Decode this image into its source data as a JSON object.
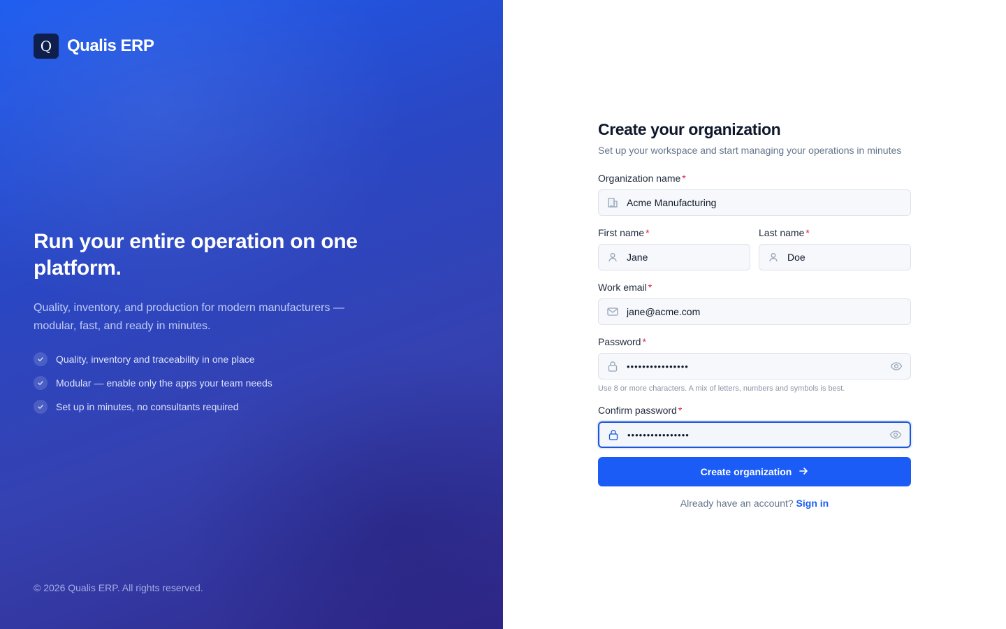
{
  "brand": {
    "logo_letter": "Q",
    "name": "Qualis ERP",
    "hero_title": "Run your entire operation on one platform.",
    "hero_subtitle": "Quality, inventory, and production for modern manufacturers — modular, fast, and ready in minutes.",
    "features": [
      "Quality, inventory and traceability in one place",
      "Modular — enable only the apps your team needs",
      "Set up in minutes, no consultants required"
    ],
    "copyright": "© 2026 Qualis ERP. All rights reserved."
  },
  "form": {
    "title": "Create your organization",
    "subtitle": "Set up your workspace and start managing your operations in minutes",
    "org_name": {
      "label": "Organization name",
      "value": "Acme Manufacturing"
    },
    "first_name": {
      "label": "First name",
      "value": "Jane"
    },
    "last_name": {
      "label": "Last name",
      "value": "Doe"
    },
    "email": {
      "label": "Work email",
      "value": "jane@acme.com"
    },
    "password": {
      "label": "Password",
      "value": "••••••••••••••••",
      "hint": "Use 8 or more characters. A mix of letters, numbers and symbols is best."
    },
    "confirm_password": {
      "label": "Confirm password",
      "value": "••••••••••••••••"
    },
    "required_marker": "*",
    "submit_label": "Create organization",
    "signin_prompt": "Already have an account?",
    "signin_link": "Sign in"
  },
  "colors": {
    "accent": "#1a5cf5",
    "required": "#e11d48",
    "panel_start": "#1d5cf0",
    "panel_end": "#30288a"
  }
}
